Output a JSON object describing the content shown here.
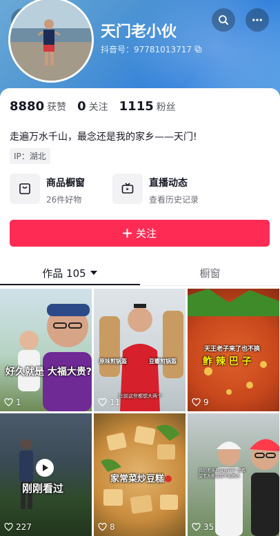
{
  "header": {
    "username": "天门老小伙",
    "douyin_id": "抖音号：97781013717",
    "back_icon": "back-icon",
    "search_icon": "search-icon",
    "more_icon": "more-icon"
  },
  "stats": {
    "likes": "8880",
    "likes_label": "获赞",
    "following": "0",
    "following_label": "关注",
    "followers": "1115",
    "followers_label": "粉丝"
  },
  "bio": "走遍万水千山，最念还是我的家乡——天门!",
  "ip": "IP：湖北",
  "features": [
    {
      "title": "商品橱窗",
      "subtitle": "26件好物",
      "icon": "shop-bag-icon"
    },
    {
      "title": "直播动态",
      "subtitle": "查看历史记录",
      "icon": "tv-icon"
    }
  ],
  "follow_button": "关注",
  "tabs": {
    "works": "作品 105",
    "showcase": "橱窗"
  },
  "videos": [
    {
      "caption": "好久就是 大福大贵?",
      "likes": "1"
    },
    {
      "caption_left": "原味煎锅盔",
      "caption_right": "豆瓣煎锅盔",
      "caption_bottom": "比前这些都想大两个",
      "likes": "11"
    },
    {
      "caption_top": "天王老子来了也不换",
      "caption": "鲊 辣 巴 子",
      "likes": "9"
    },
    {
      "caption": "刚刚看过",
      "likes": "227"
    },
    {
      "caption": "家常菜炒豆糕",
      "likes": "8"
    },
    {
      "caption": "我的老天有没有开开 我希望老天能接我不被雨水",
      "likes": "35"
    }
  ],
  "colors": {
    "accent": "#fe2c55",
    "header": "#4f95d3"
  }
}
